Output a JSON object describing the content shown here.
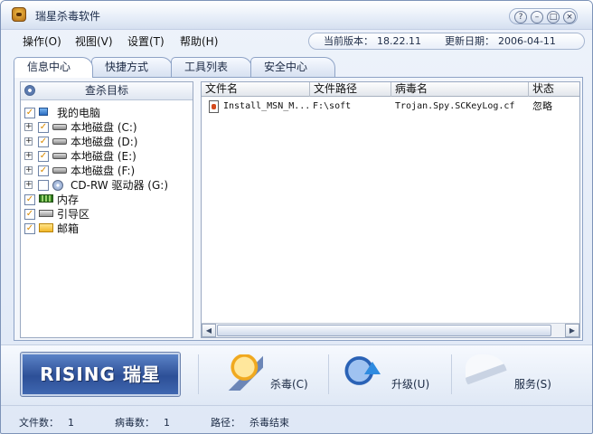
{
  "window": {
    "title": "瑞星杀毒软件"
  },
  "titlebar_buttons": {
    "help": "?",
    "minimize": "–",
    "maximize": "□",
    "close": "×"
  },
  "menu": [
    "操作(O)",
    "视图(V)",
    "设置(T)",
    "帮助(H)"
  ],
  "version_info": {
    "version_label": "当前版本：",
    "version_value": "18.22.11",
    "update_label": "更新日期：",
    "update_value": "2006-04-11"
  },
  "tabs": [
    "信息中心",
    "快捷方式",
    "工具列表",
    "安全中心"
  ],
  "active_tab": "信息中心",
  "scan_targets": {
    "header": "查杀目标",
    "items": [
      {
        "label": "我的电脑",
        "checked": true,
        "icon": "computer-icon",
        "level": 0,
        "expander": ""
      },
      {
        "label": "本地磁盘 (C:)",
        "checked": true,
        "icon": "disk-icon",
        "level": 1,
        "expander": "+"
      },
      {
        "label": "本地磁盘 (D:)",
        "checked": true,
        "icon": "disk-icon",
        "level": 1,
        "expander": "+"
      },
      {
        "label": "本地磁盘 (E:)",
        "checked": true,
        "icon": "disk-icon",
        "level": 1,
        "expander": "+"
      },
      {
        "label": "本地磁盘 (F:)",
        "checked": true,
        "icon": "disk-icon",
        "level": 1,
        "expander": "+"
      },
      {
        "label": "CD-RW 驱动器 (G:)",
        "checked": false,
        "icon": "cd-drive-icon",
        "level": 1,
        "expander": "+"
      },
      {
        "label": "内存",
        "checked": true,
        "icon": "memory-icon",
        "level": 0,
        "expander": ""
      },
      {
        "label": "引导区",
        "checked": true,
        "icon": "boot-sector-icon",
        "level": 0,
        "expander": ""
      },
      {
        "label": "邮箱",
        "checked": true,
        "icon": "mailbox-icon",
        "level": 0,
        "expander": ""
      }
    ]
  },
  "results": {
    "columns": [
      "文件名",
      "文件路径",
      "病毒名",
      "状态"
    ],
    "rows": [
      {
        "filename": "Install_MSN_M...",
        "path": "F:\\soft",
        "virus": "Trojan.Spy.SCKeyLog.cf",
        "status": "忽略"
      }
    ],
    "scroll_left": "◀",
    "scroll_right": "▶"
  },
  "logo_text": "RISING 瑞星",
  "actions": {
    "scan": "杀毒(C)",
    "update": "升级(U)",
    "service": "服务(S)"
  },
  "status_bar": {
    "files_label": "文件数：",
    "files_value": "1",
    "virus_label": "病毒数：",
    "virus_value": "1",
    "path_label": "路径：",
    "path_value": "杀毒结束"
  }
}
